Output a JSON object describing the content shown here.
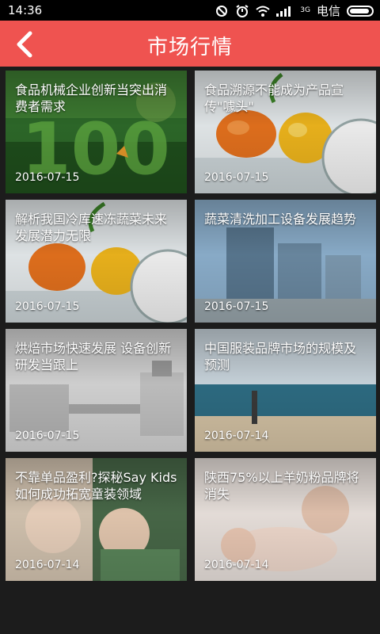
{
  "status": {
    "time": "14:36",
    "carrier": "电信",
    "network": "3G"
  },
  "header": {
    "title": "市场行情",
    "back_icon": "back-arrow-icon",
    "bar_color": "#ef5350"
  },
  "articles": [
    {
      "title": "食品机械企业创新当突出消费者需求",
      "date": "2016-07-15"
    },
    {
      "title": "食品溯源不能成为产品宣传\"噱头\"",
      "date": "2016-07-15"
    },
    {
      "title": "解析我国冷库速冻蔬菜未来发展潜力无限",
      "date": "2016-07-15"
    },
    {
      "title": "蔬菜清洗加工设备发展趋势",
      "date": "2016-07-15"
    },
    {
      "title": "烘焙市场快速发展 设备创新研发当跟上",
      "date": "2016-07-15"
    },
    {
      "title": "中国服装品牌市场的规模及预测",
      "date": "2016-07-14"
    },
    {
      "title": "不靠单品盈利?探秘Say Kids 如何成功拓宽童装领域",
      "date": "2016-07-14"
    },
    {
      "title": "陕西75%以上羊奶粉品牌将消失",
      "date": "2016-07-14"
    }
  ]
}
